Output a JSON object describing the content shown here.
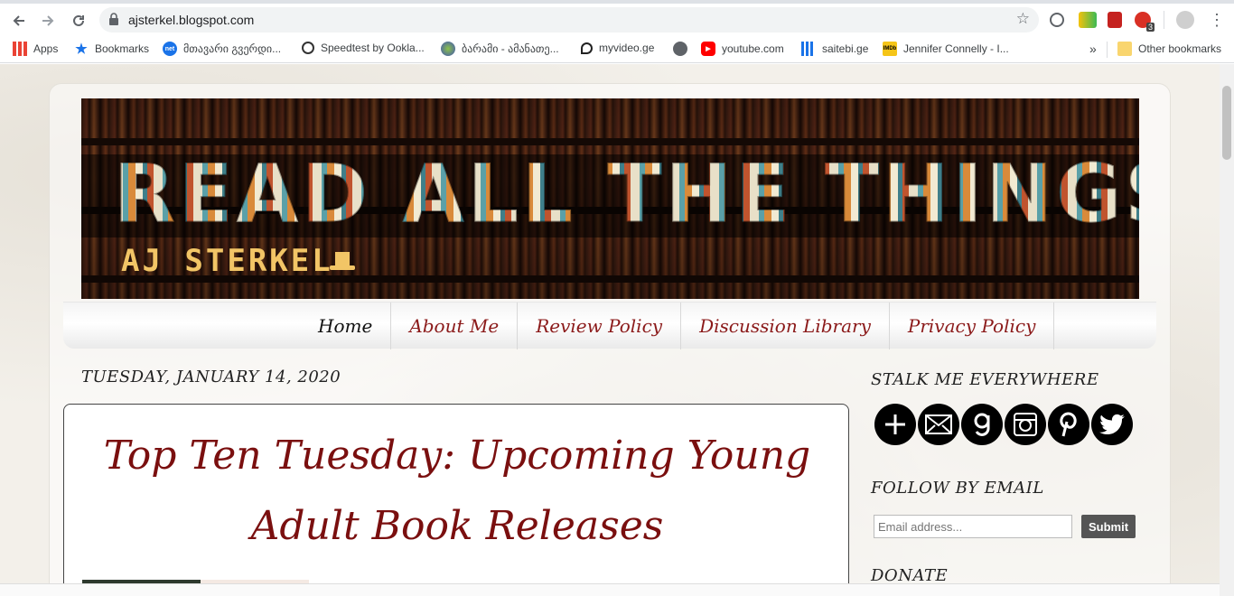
{
  "browser": {
    "url": "ajsterkel.blogspot.com",
    "bookmarks": [
      {
        "label": "Apps",
        "icon": "apps-grid-icon"
      },
      {
        "label": "Bookmarks",
        "icon": "star-icon"
      },
      {
        "label": "მთავარი გვერდი...",
        "icon": "net-icon",
        "icon_text": "net"
      },
      {
        "label": "Speedtest by Ookla...",
        "icon": "speedometer-icon"
      },
      {
        "label": "ბარამი - ამანათე...",
        "icon": "globe-icon"
      },
      {
        "label": "myvideo.ge",
        "icon": "myvideo-icon"
      },
      {
        "label": "",
        "icon": "globe-icon"
      },
      {
        "label": "youtube.com",
        "icon": "youtube-icon"
      },
      {
        "label": "saitebi.ge",
        "icon": "bar-chart-icon"
      },
      {
        "label": "Jennifer Connelly - I...",
        "icon": "imdb-icon",
        "icon_text": "IMDb"
      }
    ],
    "overflow": "»",
    "other_bookmarks": "Other bookmarks",
    "extension_badge": "3"
  },
  "header": {
    "title": "READ ALL THE THINGS!",
    "subtitle": "AJ STERKEL"
  },
  "nav": {
    "tabs": [
      {
        "label": "Home",
        "active": true
      },
      {
        "label": "About Me",
        "active": false
      },
      {
        "label": "Review Policy",
        "active": false
      },
      {
        "label": "Discussion Library",
        "active": false
      },
      {
        "label": "Privacy Policy",
        "active": false
      }
    ]
  },
  "post": {
    "date": "TUESDAY, JANUARY 14, 2020",
    "title": "Top Ten Tuesday: Upcoming Young Adult Book Releases"
  },
  "sidebar": {
    "stalk_heading": "STALK ME EVERYWHERE",
    "social": [
      "plus-icon",
      "mail-icon",
      "goodreads-icon",
      "instagram-icon",
      "pinterest-icon",
      "twitter-icon"
    ],
    "follow_heading": "FOLLOW BY EMAIL",
    "email_placeholder": "Email address...",
    "submit_label": "Submit",
    "donate_heading": "DONATE"
  },
  "colors": {
    "title_red": "#7a0f0f",
    "tab_red": "#8b1a1a",
    "page_bg": "#f3f0ea"
  }
}
